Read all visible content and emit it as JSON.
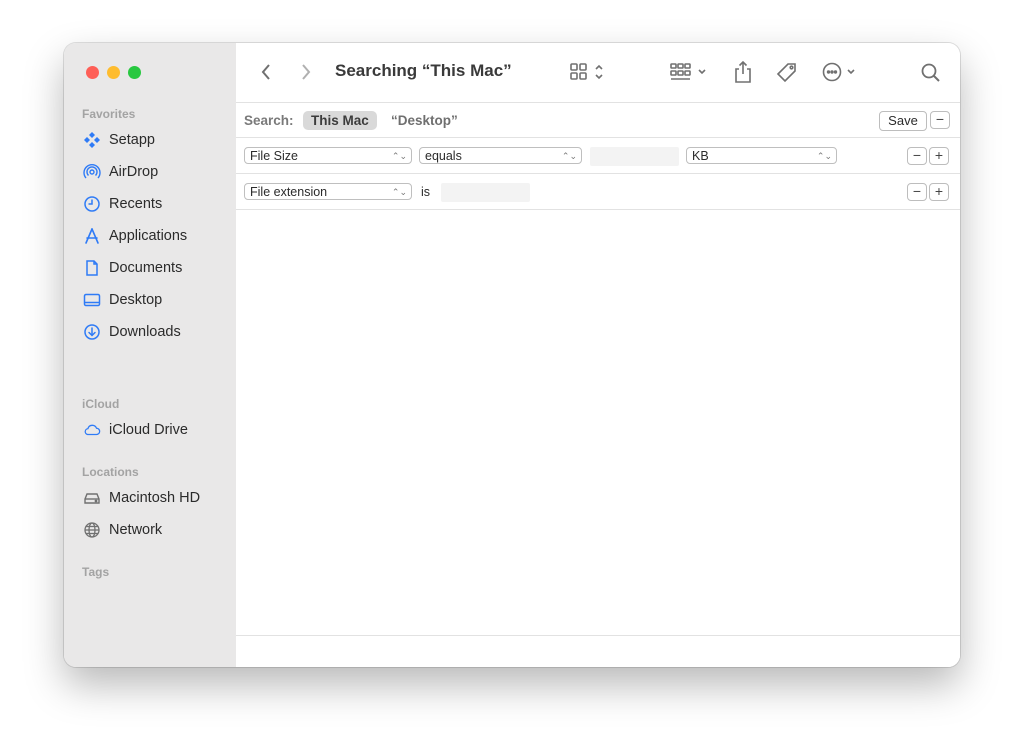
{
  "window": {
    "title": "Searching “This Mac”"
  },
  "sidebar": {
    "favorites_title": "Favorites",
    "favorites": [
      {
        "label": "Setapp",
        "icon": "setapp-icon"
      },
      {
        "label": "AirDrop",
        "icon": "airdrop-icon"
      },
      {
        "label": "Recents",
        "icon": "clock-icon"
      },
      {
        "label": "Applications",
        "icon": "applications-icon"
      },
      {
        "label": "Documents",
        "icon": "document-icon"
      },
      {
        "label": "Desktop",
        "icon": "desktop-icon"
      },
      {
        "label": "Downloads",
        "icon": "download-icon"
      }
    ],
    "icloud_title": "iCloud",
    "icloud": [
      {
        "label": "iCloud Drive",
        "icon": "cloud-icon"
      }
    ],
    "locations_title": "Locations",
    "locations": [
      {
        "label": "Macintosh HD",
        "icon": "drive-icon"
      },
      {
        "label": "Network",
        "icon": "globe-icon"
      }
    ],
    "tags_title": "Tags"
  },
  "search": {
    "label": "Search:",
    "scope_selected": "This Mac",
    "scope_other": "“Desktop”",
    "save_label": "Save",
    "minus": "−",
    "plus": "+"
  },
  "rules": [
    {
      "attribute": "File Size",
      "operator": "equals",
      "value": "",
      "unit": "KB"
    },
    {
      "attribute": "File extension",
      "operator": "is",
      "value": ""
    }
  ],
  "colors": {
    "accent": "#2f7bf6",
    "sidebar_bg": "#e9e8e8",
    "traffic_red": "#fe5f57",
    "traffic_yellow": "#febc2e",
    "traffic_green": "#28c840"
  }
}
